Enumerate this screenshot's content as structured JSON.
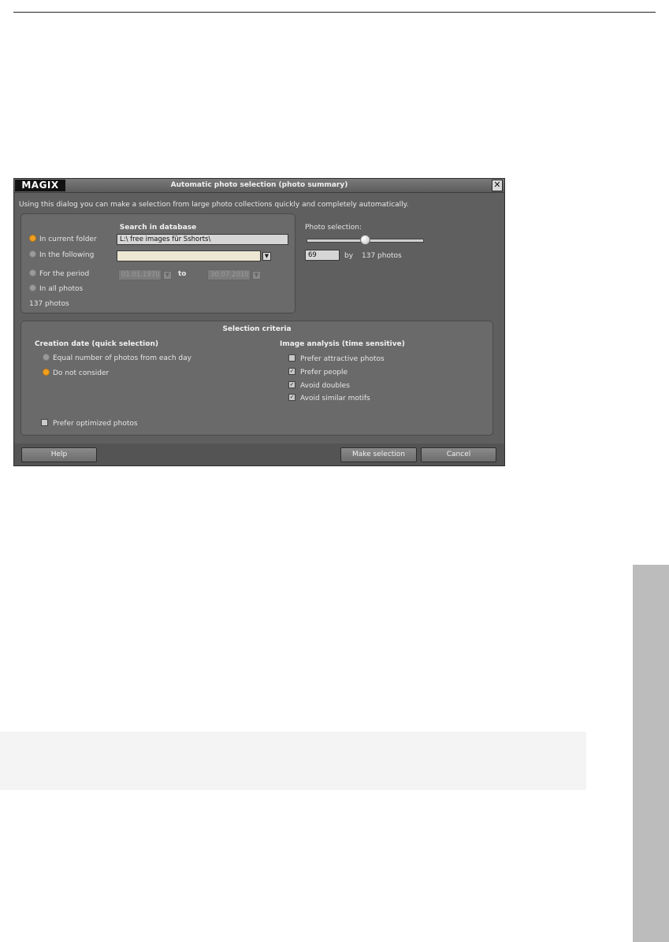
{
  "dialog": {
    "logo": "MAGIX",
    "title": "Automatic photo selection (photo summary)",
    "close_glyph": "✕",
    "intro": "Using this dialog you can make a selection from large photo collections quickly and completely automatically."
  },
  "search": {
    "title": "Search in database",
    "options": [
      {
        "label": "In current folder",
        "selected": true
      },
      {
        "label": "In the following",
        "selected": false
      },
      {
        "label": "For the period",
        "selected": false
      },
      {
        "label": "In all photos",
        "selected": false
      }
    ],
    "folder_value": "L:\\  free images für Sshorts\\",
    "following_value": "",
    "period_from": "01.01.1970",
    "period_to_label": "to",
    "period_to": "30.07.2010",
    "count_text": "137 photos"
  },
  "photo_selection": {
    "label": "Photo selection:",
    "slider_fraction": 0.5,
    "value": "69",
    "by_label": "by",
    "total_text": "137 photos"
  },
  "criteria": {
    "title": "Selection criteria",
    "creation_title": "Creation date (quick selection)",
    "creation_options": [
      {
        "label": "Equal number of photos from each day",
        "selected": false
      },
      {
        "label": "Do not consider",
        "selected": true
      }
    ],
    "analysis_title": "Image analysis (time sensitive)",
    "analysis_options": [
      {
        "label": "Prefer attractive photos",
        "checked": false
      },
      {
        "label": "Prefer people",
        "checked": true
      },
      {
        "label": "Avoid doubles",
        "checked": true
      },
      {
        "label": "Avoid similar motifs",
        "checked": true
      }
    ],
    "optimized_label": "Prefer optimized photos",
    "optimized_checked": false
  },
  "buttons": {
    "help": "Help",
    "make_selection": "Make selection",
    "cancel": "Cancel"
  },
  "colors": {
    "dialog_bg": "#5f5f5f",
    "panel_bg": "#6a6a6a",
    "radio_active": "#f0a020",
    "side_tab": "#bcbcbc"
  }
}
